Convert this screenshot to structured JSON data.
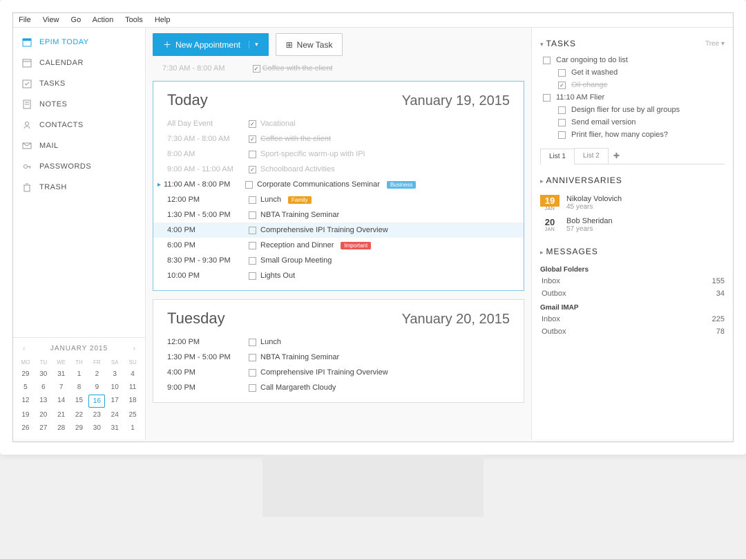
{
  "menubar": [
    "File",
    "View",
    "Go",
    "Action",
    "Tools",
    "Help"
  ],
  "sidebar": {
    "items": [
      {
        "label": "EPIM TODAY",
        "icon": "today"
      },
      {
        "label": "CALENDAR",
        "icon": "calendar"
      },
      {
        "label": "TASKS",
        "icon": "tasks"
      },
      {
        "label": "NOTES",
        "icon": "notes"
      },
      {
        "label": "CONTACTS",
        "icon": "contacts"
      },
      {
        "label": "MAIL",
        "icon": "mail"
      },
      {
        "label": "PASSWORDS",
        "icon": "passwords"
      },
      {
        "label": "TRASH",
        "icon": "trash"
      }
    ]
  },
  "datepicker": {
    "month_label": "JANUARY 2015",
    "dow": [
      "MO",
      "TU",
      "WE",
      "TH",
      "FR",
      "SA",
      "SU"
    ],
    "weeks": [
      [
        29,
        30,
        31,
        1,
        2,
        3,
        4
      ],
      [
        5,
        6,
        7,
        8,
        9,
        10,
        11
      ],
      [
        12,
        13,
        14,
        15,
        16,
        17,
        18
      ],
      [
        19,
        20,
        21,
        22,
        23,
        24,
        25
      ],
      [
        26,
        27,
        28,
        29,
        30,
        31,
        1
      ]
    ],
    "today": 16
  },
  "toolbar": {
    "new_appt": "New Appointment",
    "new_task": "New Task"
  },
  "ghost_row": {
    "time": "7:30 AM - 8:00 AM",
    "text": "Coffee with the client"
  },
  "days": [
    {
      "title": "Today",
      "date": "Yanuary 19, 2015",
      "rows": [
        {
          "time": "All Day Event",
          "text": "Vacational",
          "checked": true,
          "past": true
        },
        {
          "time": "7:30 AM - 8:00 AM",
          "text": "Coffee with the client",
          "checked": true,
          "strike": true,
          "past": true
        },
        {
          "time": "8:00 AM",
          "text": "Sport-specific warm-up with IPI",
          "past": true
        },
        {
          "time": "9:00 AM - 11:00 AM",
          "text": "Schoolboard Activities",
          "checked": true,
          "past": true
        },
        {
          "time": "11:00 AM - 8:00 PM",
          "text": "Corporate Communications Seminar",
          "badge": "Business",
          "badgeClass": "business",
          "current": true
        },
        {
          "time": "12:00 PM",
          "text": "Lunch",
          "badge": "Family",
          "badgeClass": "family"
        },
        {
          "time": "1:30 PM - 5:00 PM",
          "text": "NBTA Training Seminar"
        },
        {
          "time": "4:00 PM",
          "text": "Comprehensive IPI Training Overview",
          "highlight": true
        },
        {
          "time": "6:00 PM",
          "text": "Reception and Dinner",
          "badge": "Important",
          "badgeClass": "important"
        },
        {
          "time": "8:30 PM - 9:30 PM",
          "text": "Small Group Meeting"
        },
        {
          "time": "10:00 PM",
          "text": "Lights Out"
        }
      ]
    },
    {
      "title": "Tuesday",
      "date": "Yanuary 20, 2015",
      "rows": [
        {
          "time": "12:00 PM",
          "text": "Lunch"
        },
        {
          "time": "1:30 PM - 5:00 PM",
          "text": "NBTA Training Seminar"
        },
        {
          "time": "4:00 PM",
          "text": "Comprehensive IPI Training Overview"
        },
        {
          "time": "9:00 PM",
          "text": "Call Margareth Cloudy"
        }
      ]
    }
  ],
  "tasks": {
    "title": "TASKS",
    "tree": "Tree",
    "groups": [
      {
        "label": "Car ongoing to do list",
        "sub": [
          {
            "label": "Get it washed"
          },
          {
            "label": "Oil change",
            "checked": true,
            "strike": true
          }
        ]
      },
      {
        "label": "11:10 AM Flier",
        "sub": [
          {
            "label": "Design flier for use by all groups"
          },
          {
            "label": "Send email version"
          },
          {
            "label": "Print flier, how many copies?"
          }
        ]
      }
    ],
    "tabs": [
      "List 1",
      "List 2"
    ]
  },
  "anniversaries": {
    "title": "ANNIVERSARIES",
    "items": [
      {
        "day": "19",
        "mon": "JAN",
        "name": "Nikolay Volovich",
        "years": "45 years",
        "hl": true
      },
      {
        "day": "20",
        "mon": "JAN",
        "name": "Bob Sheridan",
        "years": "57 years"
      }
    ]
  },
  "messages": {
    "title": "MESSAGES",
    "groups": [
      {
        "name": "Global Folders",
        "folders": [
          {
            "name": "Inbox",
            "count": 155
          },
          {
            "name": "Outbox",
            "count": 34
          }
        ]
      },
      {
        "name": "Gmail IMAP",
        "folders": [
          {
            "name": "Inbox",
            "count": 225
          },
          {
            "name": "Outbox",
            "count": 78
          }
        ]
      }
    ]
  }
}
